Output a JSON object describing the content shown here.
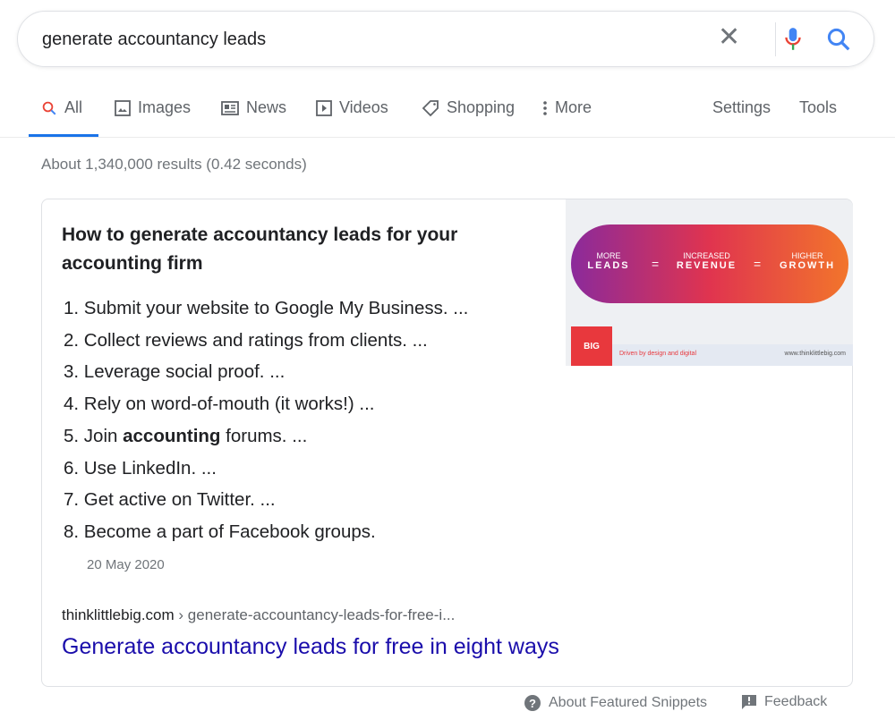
{
  "search": {
    "query": "generate accountancy leads"
  },
  "tabs": [
    {
      "label": "All",
      "icon": "search-icon"
    },
    {
      "label": "Images",
      "icon": "image-icon"
    },
    {
      "label": "News",
      "icon": "news-icon"
    },
    {
      "label": "Videos",
      "icon": "play-icon"
    },
    {
      "label": "Shopping",
      "icon": "tag-icon"
    },
    {
      "label": "More",
      "icon": "more-vert-icon"
    }
  ],
  "tools": {
    "settings": "Settings",
    "tools": "Tools"
  },
  "stats": "About 1,340,000 results (0.42 seconds)",
  "snippet": {
    "title": "How to generate accountancy leads for your accounting firm",
    "items": [
      {
        "pre": "1. Submit your website to Google My Business. ...",
        "bold": "",
        "post": ""
      },
      {
        "pre": "2. Collect reviews and ratings from clients. ...",
        "bold": "",
        "post": ""
      },
      {
        "pre": "3. Leverage social proof. ...",
        "bold": "",
        "post": ""
      },
      {
        "pre": "4. Rely on word-of-mouth (it works!) ...",
        "bold": "",
        "post": ""
      },
      {
        "pre": "5. Join ",
        "bold": "accounting",
        "post": " forums. ..."
      },
      {
        "pre": "6. Use LinkedIn. ...",
        "bold": "",
        "post": ""
      },
      {
        "pre": "7. Get active on Twitter. ...",
        "bold": "",
        "post": ""
      },
      {
        "pre": "8. Become a part of Facebook groups.",
        "bold": "",
        "post": ""
      }
    ],
    "date": "20 May 2020",
    "site": "thinklittlebig.com",
    "path": " › generate-accountancy-leads-for-free-i...",
    "link": "Generate accountancy leads for free in eight ways",
    "image": {
      "b1a": "MORE",
      "b1b": "LEADS",
      "b2a": "INCREASED",
      "b2b": "REVENUE",
      "b3a": "HIGHER",
      "b3b": "GROWTH",
      "eq": "=",
      "logo": "BIG",
      "tagline": "Driven by design and digital",
      "url": "www.thinklittlebig.com"
    }
  },
  "footer": {
    "about": "About Featured Snippets",
    "feedback": "Feedback"
  },
  "colors": {
    "accent": "#1a73e8",
    "link": "#1a0dab"
  }
}
